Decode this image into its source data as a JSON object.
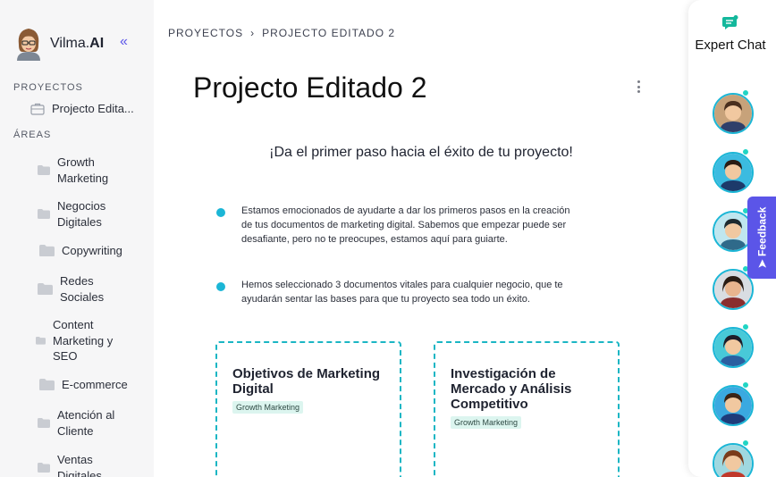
{
  "brand": {
    "name_plain": "Vilma.",
    "name_bold": "AI",
    "collapse_glyph": "«"
  },
  "sidebar": {
    "projects_label": "PROYECTOS",
    "project_item": "Projecto Edita...",
    "areas_label": "ÁREAS",
    "areas": [
      "Growth Marketing",
      "Negocios Digitales",
      "Copywriting",
      "Redes Sociales",
      "Content Marketing y SEO",
      "E-commerce",
      "Atención al Cliente",
      "Ventas Digitales"
    ]
  },
  "breadcrumb": {
    "root": "PROYECTOS",
    "separator": "›",
    "current": "PROJECTO EDITADO 2"
  },
  "main": {
    "title": "Projecto Editado 2",
    "subtitle": "¡Da el primer paso hacia el éxito de tu proyecto!",
    "bullets": [
      "Estamos emocionados de ayudarte a dar los primeros pasos en la creación de tus documentos de marketing digital. Sabemos que empezar puede ser desafiante, pero no te preocupes, estamos aquí para guiarte.",
      "Hemos seleccionado 3 documentos vitales para cualquier negocio, que te ayudarán sentar las bases para que tu proyecto sea todo un éxito."
    ],
    "cards": [
      {
        "title": "Objetivos de Marketing Digital",
        "tag": "Growth Marketing"
      },
      {
        "title": "Investigación de Mercado y Análisis Competitivo",
        "tag": "Growth Marketing"
      }
    ]
  },
  "right_panel": {
    "expert_title": "Expert Chat",
    "feedback_label": "Feedback"
  },
  "colors": {
    "accent": "#5b55e8",
    "teal": "#1bb6d6",
    "tag_bg": "#dcf5ef",
    "sidebar_bg": "#f6f6f7"
  }
}
